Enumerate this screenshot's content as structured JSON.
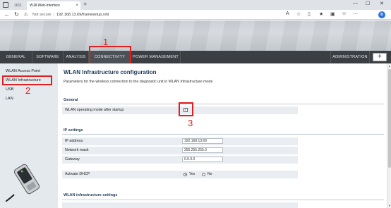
{
  "browser": {
    "inactive_tab": "1611",
    "active_tab": "WJA Web-Interface",
    "tab_close": "×",
    "new_tab": "+",
    "url_warning": "Not secure",
    "url": "192.168.13.69/framesetup.xml"
  },
  "menu": {
    "items": [
      "GENERAL",
      "SOFTWARE",
      "ANALYSIS",
      "CONNECTIVITY",
      "POWER MANAGEMENT"
    ],
    "admin": "ADMINISTRATION",
    "active": "CONNECTIVITY"
  },
  "sidebar": {
    "items": [
      "WLAN Access Point",
      "WLAN Infrastructure",
      "USB",
      "LAN"
    ],
    "active": "WLAN Infrastructure"
  },
  "page": {
    "title": "WLAN Infrastructure configuration",
    "description": "Parameters for the wireless connection to the diagnostic unit in WLAN Infrastructure mode"
  },
  "general": {
    "title": "General",
    "wlan_mode_label": "WLAN operating mode after startup",
    "wlan_mode_checked": true,
    "checkmark": "✓"
  },
  "ip": {
    "title": "IP settings",
    "address_label": "IP address",
    "address_value": "192.168.13.69",
    "mask_label": "Network mask",
    "mask_value": "255.255.255.0",
    "gateway_label": "Gateway",
    "gateway_value": "0.0.0.0",
    "dhcp_label": "Activate DHCP",
    "dhcp_yes": "Yes",
    "dhcp_no": "No",
    "dhcp_selected": "Yes"
  },
  "wlan_settings": {
    "title": "WLAN infrastructure settings"
  },
  "annotations": {
    "n1": "1",
    "n2": "2",
    "n3": "3",
    "color": "#e02020"
  }
}
